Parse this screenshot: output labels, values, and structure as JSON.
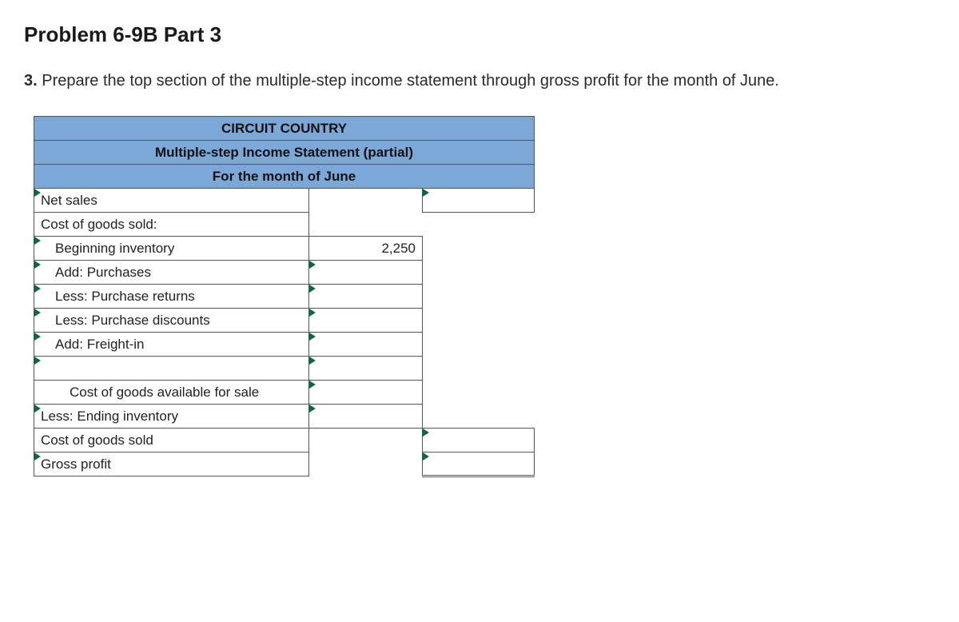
{
  "title": "Problem 6-9B Part 3",
  "instruction_num": "3.",
  "instruction_text": "Prepare the top section of the multiple-step income statement through gross profit for the month of June.",
  "header": {
    "company": "CIRCUIT COUNTRY",
    "title": "Multiple-step Income Statement (partial)",
    "period": "For the month of June"
  },
  "rows": {
    "net_sales": "Net sales",
    "cogs_hdr": "Cost of goods sold:",
    "beg_inv": "Beginning inventory",
    "beg_inv_val": "2,250",
    "add_purch": "Add: Purchases",
    "less_ret": "Less: Purchase returns",
    "less_disc": "Less: Purchase discounts",
    "add_freight": "Add: Freight-in",
    "cga": "Cost of goods available for sale",
    "less_end": "Less: Ending inventory",
    "cogs": "Cost of goods sold",
    "gross": "Gross profit"
  }
}
